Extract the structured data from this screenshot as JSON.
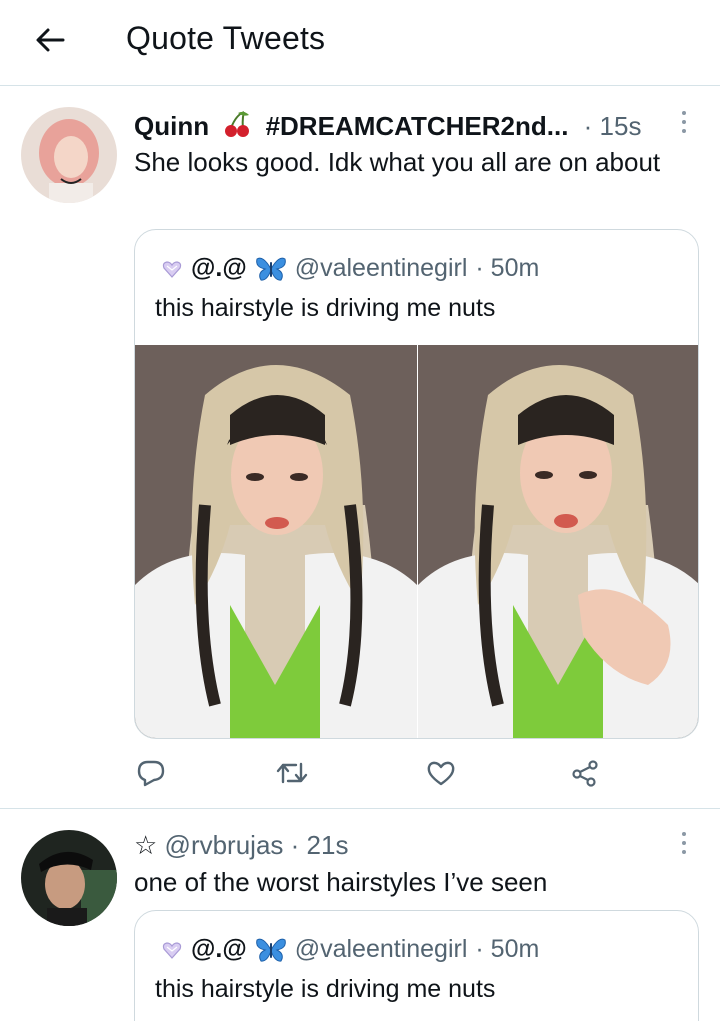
{
  "header": {
    "title": "Quote Tweets",
    "back_icon": "arrow-left-icon"
  },
  "colors": {
    "text": "#0f1419",
    "muted": "#536471",
    "divider": "#d6e3e8",
    "icon": "#536471"
  },
  "tweets": [
    {
      "name": "Quinn",
      "name_tag": "#DREAMCATCHER2nd...",
      "time": "· 15s",
      "text": "She looks good. Idk what you all are on about",
      "quote": {
        "display_name": "@.@",
        "handle": "@valeentinegirl",
        "time": "· 50m",
        "text": "this hairstyle is driving me nuts"
      },
      "actions": [
        "reply-icon",
        "retweet-icon",
        "like-icon",
        "share-icon"
      ]
    },
    {
      "name_prefix": "☆",
      "handle": "@rvbrujas",
      "time": "· 21s",
      "text": "one of the worst hairstyles I’ve seen",
      "quote": {
        "display_name": "@.@",
        "handle": "@valeentinegirl",
        "time": "· 50m",
        "text": "this hairstyle is driving me nuts"
      }
    }
  ]
}
